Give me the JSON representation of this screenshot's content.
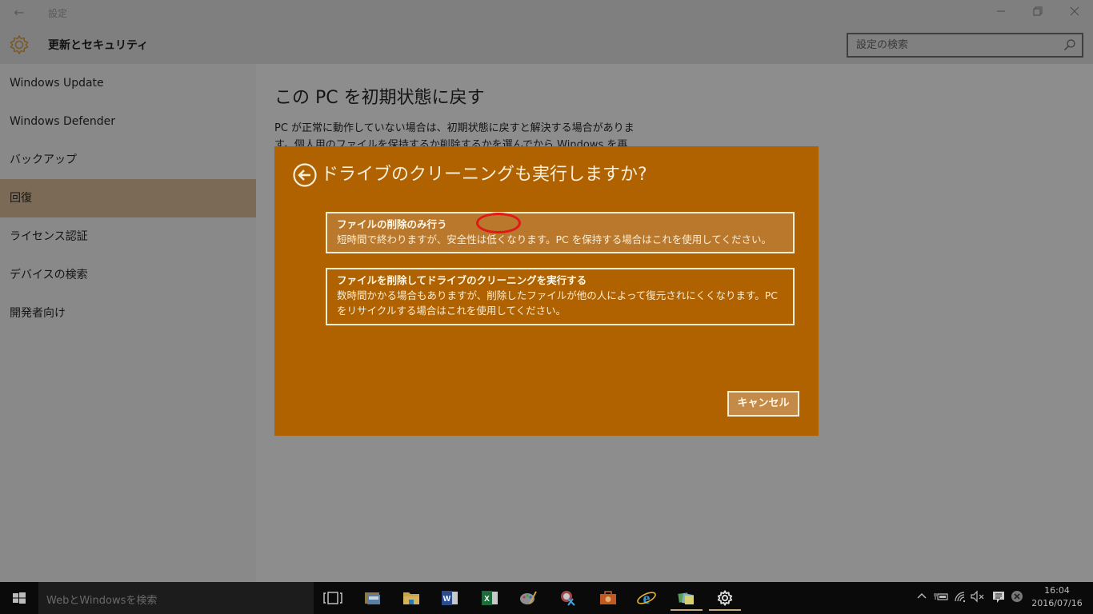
{
  "window": {
    "app_title": "設定",
    "back_icon": "back-arrow-icon",
    "minimize_icon": "minimize-icon",
    "restore_icon": "restore-icon",
    "close_icon": "close-icon"
  },
  "header": {
    "title": "更新とセキュリティ",
    "icon": "gear-icon",
    "search_placeholder": "設定の検索"
  },
  "sidebar": {
    "items": [
      {
        "label": "Windows Update",
        "active": false
      },
      {
        "label": "Windows Defender",
        "active": false
      },
      {
        "label": "バックアップ",
        "active": false
      },
      {
        "label": "回復",
        "active": true
      },
      {
        "label": "ライセンス認証",
        "active": false
      },
      {
        "label": "デバイスの検索",
        "active": false
      },
      {
        "label": "開発者向け",
        "active": false
      }
    ]
  },
  "main": {
    "title": "この PC を初期状態に戻す",
    "description": "PC が正常に動作していない場合は、初期状態に戻すと解決する場合があります。個人用のファイルを保持するか削除するかを選んでから Windows を再"
  },
  "dialog": {
    "title": "ドライブのクリーニングも実行しますか?",
    "accent_color": "#b06100",
    "options": [
      {
        "title": "ファイルの削除のみ行う",
        "description": "短時間で終わりますが、安全性は低くなります。PC を保持する場合はこれを使用してください。"
      },
      {
        "title": "ファイルを削除してドライブのクリーニングを実行する",
        "description": "数時間かかる場合もありますが、削除したファイルが他の人によって復元されにくくなります。PC をリサイクルする場合はこれを使用してください。"
      }
    ],
    "cancel_label": "キャンセル"
  },
  "taskbar": {
    "search_placeholder": "WebとWindowsを検索",
    "apps": [
      {
        "name": "task-view-icon"
      },
      {
        "name": "mail-app-icon"
      },
      {
        "name": "file-explorer-icon"
      },
      {
        "name": "word-icon"
      },
      {
        "name": "excel-icon"
      },
      {
        "name": "paint-icon"
      },
      {
        "name": "snipping-tool-icon"
      },
      {
        "name": "briefcase-app-icon"
      },
      {
        "name": "internet-explorer-icon"
      },
      {
        "name": "sticky-notes-icon"
      },
      {
        "name": "settings-icon"
      }
    ],
    "tray": {
      "time": "16:04",
      "date": "2016/07/16"
    }
  }
}
